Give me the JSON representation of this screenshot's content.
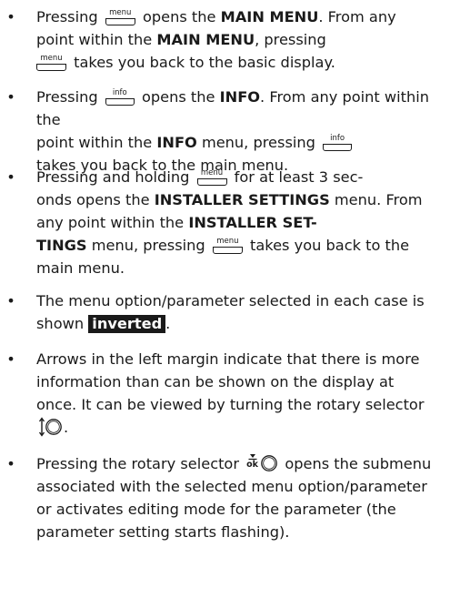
{
  "bullet": "•",
  "key_labels": {
    "menu": "menu",
    "info": "info",
    "ok": "ok"
  },
  "items": [
    {
      "t1": "Pressing",
      "t2": "opens the",
      "b1": "MAIN MENU",
      "t3": ". From any point within the",
      "b2": "MAIN MENU",
      "t4": ", pressing",
      "t5": "takes you back to the basic display."
    },
    {
      "t1": "Pressing",
      "t2": "opens the",
      "b1": "INFO",
      "t3": ". From any point within the",
      "b2": "INFO",
      "t4": "menu, pressing",
      "t5": "takes you back to the main menu."
    },
    {
      "t1": "Pressing and holding",
      "t2": "for at least 3 sec-",
      "t3": "onds opens the",
      "b1": "INSTALLER SETTINGS",
      "t4": "menu. From any point within the",
      "b2a": "INSTALLER SET-",
      "b2b": "TINGS",
      "t5": "menu, pressing",
      "t6": "takes you back to the main menu."
    },
    {
      "t1": "The menu option/parameter selected in each case is shown",
      "inv": "inverted",
      "t2": "."
    },
    {
      "t1": "Arrows in the left margin indicate that there is more information than can be shown on the display at once. It can be viewed by turning the rotary selector",
      "t2": "."
    },
    {
      "t1": "Pressing the rotary selector",
      "t2": "opens the submenu associated with the selected menu option/parameter or activates editing mode for the parameter (the parameter setting starts flashing)."
    }
  ]
}
